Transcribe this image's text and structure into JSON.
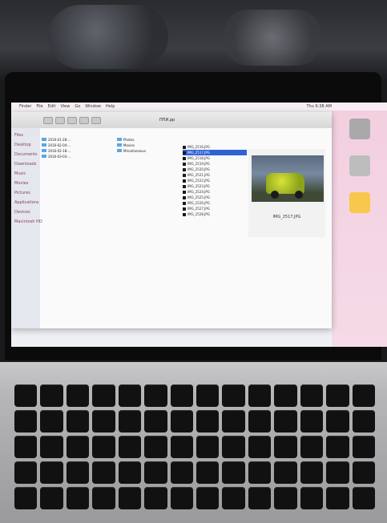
{
  "photo": {
    "menubar": {
      "items": [
        "Finder",
        "File",
        "Edit",
        "View",
        "Go",
        "Window",
        "Help"
      ],
      "clock": "Thu 9:38 AM"
    },
    "finder": {
      "window_title": "ППИ.pp",
      "sidebar_items": [
        "Files",
        "Desktop",
        "Documents",
        "Downloads",
        "Music",
        "Movies",
        "Pictures",
        "Applications",
        "Devices",
        "Macintosh HD"
      ],
      "column1": [
        "2016-01-28-...",
        "2016-02-04-...",
        "2016-02-18-...",
        "2016-03-03-..."
      ],
      "column2": [
        "Photos",
        "Movies",
        "Miscellaneous"
      ],
      "files": [
        {
          "label": "IMG_2516.JPG",
          "selected": false
        },
        {
          "label": "IMG_2517.JPG",
          "selected": true
        },
        {
          "label": "IMG_2518.JPG",
          "selected": false
        },
        {
          "label": "IMG_2519.JPG",
          "selected": false
        },
        {
          "label": "IMG_2520.JPG",
          "selected": false
        },
        {
          "label": "IMG_2521.JPG",
          "selected": false
        },
        {
          "label": "IMG_2522.JPG",
          "selected": false
        },
        {
          "label": "IMG_2523.JPG",
          "selected": false
        },
        {
          "label": "IMG_2524.JPG",
          "selected": false
        },
        {
          "label": "IMG_2525.JPG",
          "selected": false
        },
        {
          "label": "IMG_2526.JPG",
          "selected": false
        },
        {
          "label": "IMG_2527.JPG",
          "selected": false
        },
        {
          "label": "IMG_2528.JPG",
          "selected": false
        }
      ],
      "preview_caption": "IMG_2517.JPG"
    }
  }
}
